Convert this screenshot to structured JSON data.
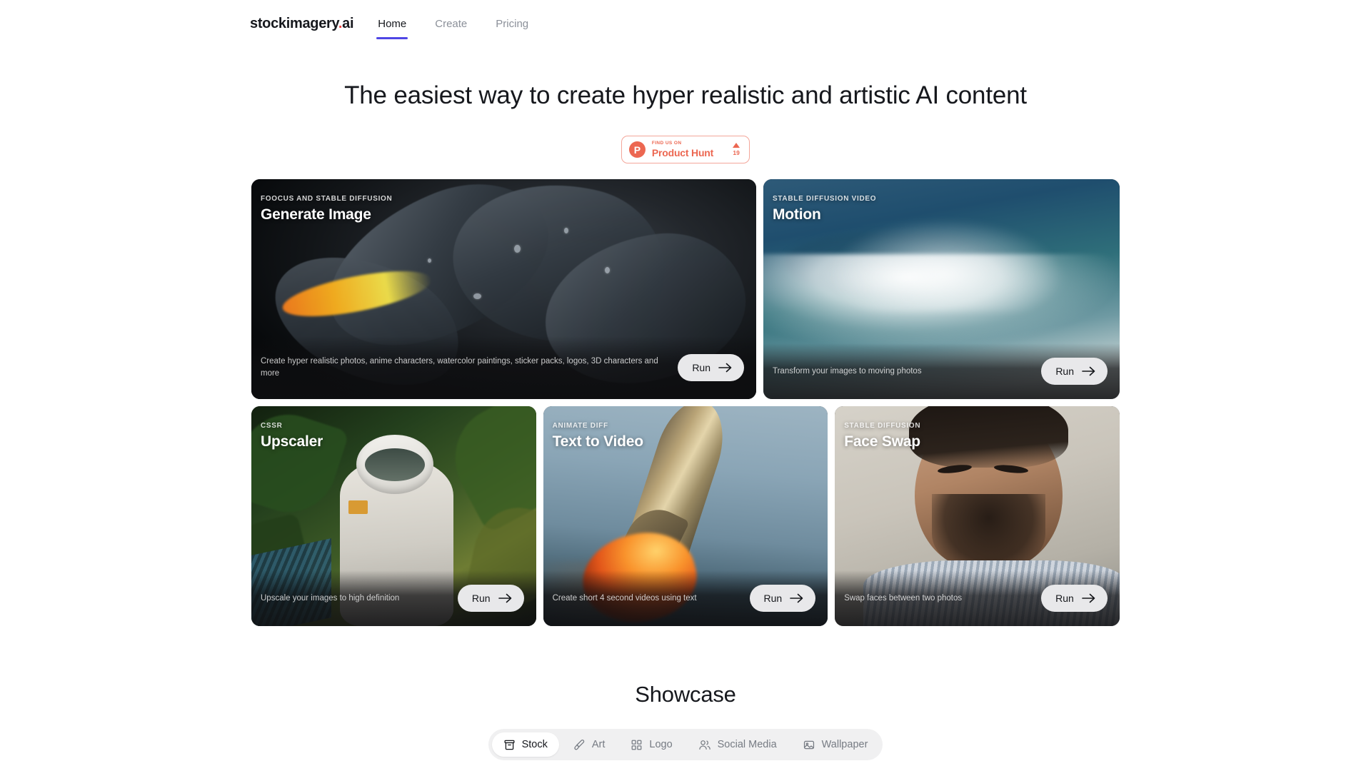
{
  "nav": {
    "brand": {
      "name": "stockimagery",
      "dot": ".",
      "tld": "ai"
    },
    "links": [
      {
        "label": "Home",
        "active": true
      },
      {
        "label": "Create",
        "active": false
      },
      {
        "label": "Pricing",
        "active": false
      }
    ]
  },
  "hero": {
    "title": "The easiest way to create hyper realistic and artistic AI content",
    "product_hunt": {
      "logo_letter": "P",
      "kicker": "FIND US ON",
      "name": "Product Hunt",
      "votes": "19"
    }
  },
  "cards": [
    {
      "kicker": "FOOCUS AND STABLE DIFFUSION",
      "title": "Generate Image",
      "description": "Create hyper realistic photos, anime characters, watercolor paintings, sticker packs, logos, 3D characters and more",
      "run_label": "Run"
    },
    {
      "kicker": "STABLE DIFFUSION VIDEO",
      "title": "Motion",
      "description": "Transform your images to moving photos",
      "run_label": "Run"
    },
    {
      "kicker": "CSSR",
      "title": "Upscaler",
      "description": "Upscale your images to high definition",
      "run_label": "Run"
    },
    {
      "kicker": "ANIMATE DIFF",
      "title": "Text to Video",
      "description": "Create short 4 second videos using text",
      "run_label": "Run"
    },
    {
      "kicker": "STABLE DIFFUSION",
      "title": "Face Swap",
      "description": "Swap faces between two photos",
      "run_label": "Run"
    }
  ],
  "showcase": {
    "title": "Showcase",
    "tabs": [
      {
        "label": "Stock",
        "icon": "archive-box-icon",
        "active": true
      },
      {
        "label": "Art",
        "icon": "paint-brush-icon",
        "active": false
      },
      {
        "label": "Logo",
        "icon": "grid-squares-icon",
        "active": false
      },
      {
        "label": "Social Media",
        "icon": "users-icon",
        "active": false
      },
      {
        "label": "Wallpaper",
        "icon": "image-icon",
        "active": false
      }
    ]
  },
  "colors": {
    "accent": "#4f46e5",
    "brand_dot": "#ef4444",
    "product_hunt": "#ec6751",
    "text": "#16181d",
    "muted": "#8b9099"
  }
}
